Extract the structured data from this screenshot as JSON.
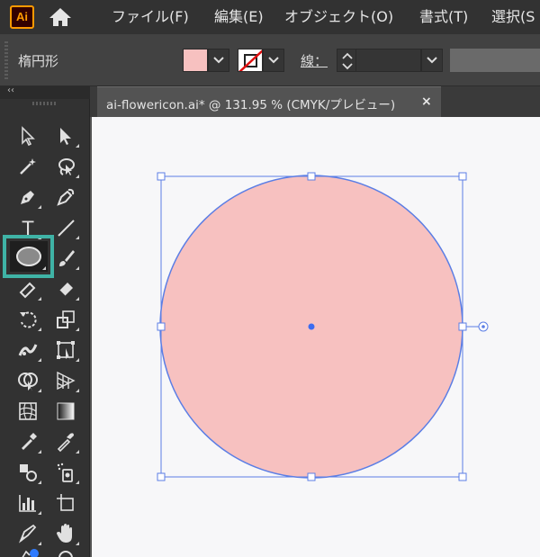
{
  "app": {
    "logo": "Ai"
  },
  "menu": [
    "ファイル(F)",
    "編集(E)",
    "オブジェクト(O)",
    "書式(T)",
    "選択(S"
  ],
  "control_bar": {
    "shape_label": "楕円形",
    "fill_color": "#f7c1c0",
    "stroke_label": "線：",
    "stroke_value": ""
  },
  "document": {
    "tab_title": "ai-flowericon.ai* @ 131.95 % (CMYK/プレビュー)",
    "close_label": "×"
  },
  "canvas": {
    "ellipse_fill": "#f7c1c0",
    "selection_color": "#5b7ee5"
  },
  "toolbar": {
    "collapse_label": "‹‹",
    "active_tool": "ellipse-tool",
    "highlight_color": "#3fb3a6",
    "text_tool_glyph": "T"
  }
}
